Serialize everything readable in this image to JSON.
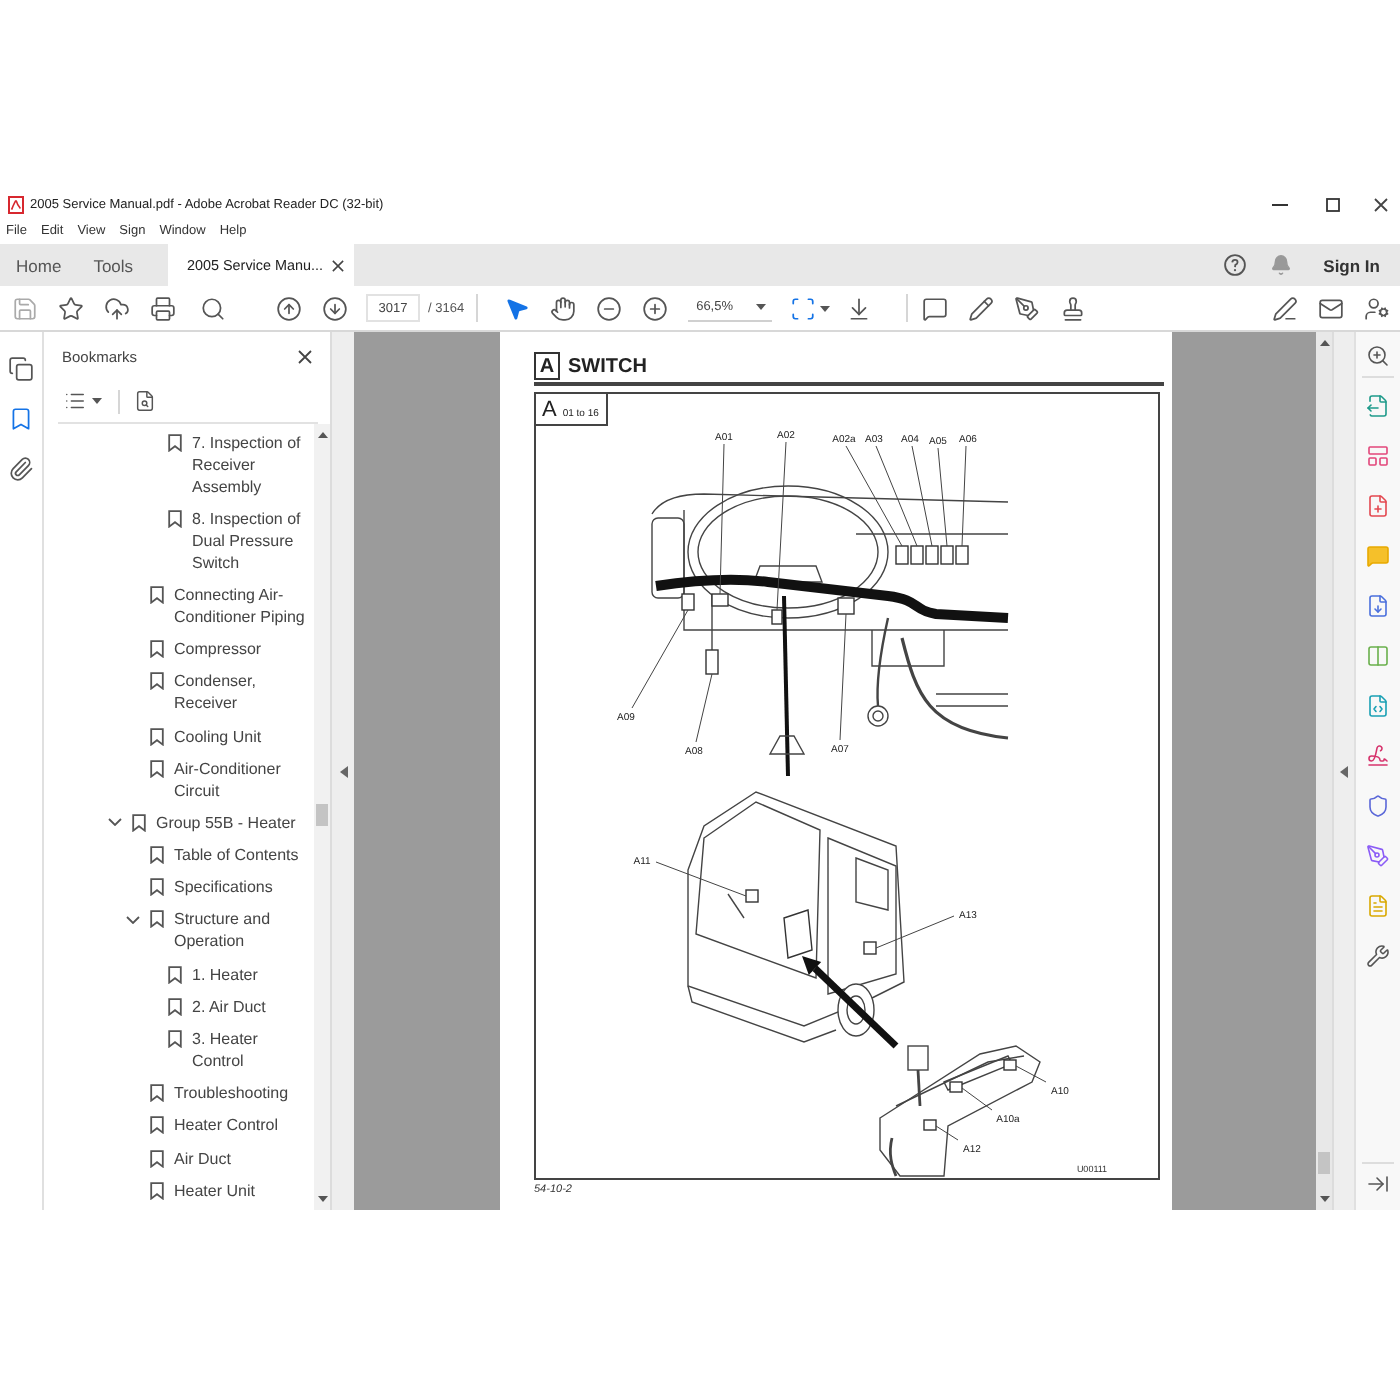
{
  "window": {
    "title": "2005 Service Manual.pdf - Adobe Acrobat Reader DC (32-bit)"
  },
  "menu": [
    "File",
    "Edit",
    "View",
    "Sign",
    "Window",
    "Help"
  ],
  "tabs": [
    {
      "label": "Home",
      "kind": "nav",
      "selected": false
    },
    {
      "label": "Tools",
      "kind": "nav",
      "selected": false
    },
    {
      "label": "2005 Service Manu...",
      "kind": "document",
      "selected": true
    }
  ],
  "account": {
    "sign_in": "Sign In"
  },
  "toolbar": {
    "page": "3017",
    "page_total": "/ 3164",
    "tools": [
      {
        "kind": "select",
        "selected": true
      },
      {
        "kind": "hand",
        "selected": false
      }
    ],
    "zoom": "66,5%"
  },
  "side_rail": [
    {
      "kind": "pages",
      "selected": false
    },
    {
      "kind": "bookmarks",
      "selected": true
    },
    {
      "kind": "attachments",
      "selected": false
    }
  ],
  "bookmarks": {
    "title": "Bookmarks",
    "items": [
      {
        "children": [
          {
            "children": [
              {
                "label": "7. Inspection of Receiver Assembly"
              },
              {
                "label": "8. Inspection of Dual Pressure Switch"
              }
            ]
          },
          {
            "label": "Connecting Air-Conditioner Piping"
          },
          {
            "label": "Compressor"
          },
          {
            "label": "Condenser, Receiver"
          },
          {
            "label": "Cooling Unit"
          },
          {
            "label": "Air-Conditioner Circuit"
          }
        ]
      },
      {
        "label": "Group 55B - Heater",
        "expanded": true,
        "children": [
          {
            "label": "Table of Contents"
          },
          {
            "label": "Specifications"
          },
          {
            "label": "Structure and Operation",
            "expanded": true,
            "children": [
              {
                "label": "1. Heater"
              },
              {
                "label": "2. Air Duct"
              },
              {
                "label": "3. Heater Control"
              }
            ]
          },
          {
            "label": "Troubleshooting"
          },
          {
            "label": "Heater Control"
          },
          {
            "label": "Air Duct"
          },
          {
            "label": "Heater Unit"
          }
        ]
      }
    ]
  },
  "document": {
    "section": {
      "letter": "A",
      "title": "SWITCH"
    },
    "figure": {
      "tag_letter": "A",
      "tag_range": "01 to 16",
      "callouts": [
        "A01",
        "A02",
        "A02a",
        "A03",
        "A04",
        "A05",
        "A06",
        "A09",
        "A08",
        "A07",
        "A11",
        "A13",
        "A10",
        "A10a",
        "A12"
      ],
      "code": "U00111"
    },
    "page_number": "54-10-2"
  }
}
